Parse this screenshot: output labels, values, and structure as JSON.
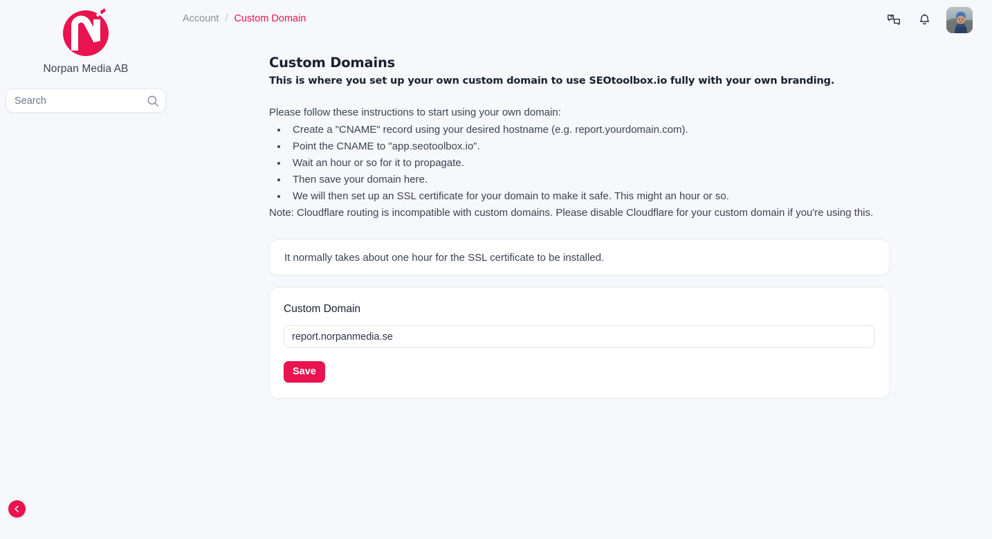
{
  "brand": {
    "name": "Norpan Media AB",
    "logo_icon": "norpan-n-monogram-logo",
    "accent_color": "#e8134f"
  },
  "sidebar": {
    "search": {
      "placeholder": "Search",
      "value": "",
      "icon": "search-icon"
    },
    "collapse_button_icon": "chevron-left-icon"
  },
  "header": {
    "breadcrumb": {
      "parent": "Account",
      "separator": "/",
      "current": "Custom Domain"
    },
    "actions": {
      "support_chat_icon": "chat-question-icon",
      "notifications_icon": "bell-icon",
      "avatar": "user-avatar"
    }
  },
  "main": {
    "title": "Custom Domains",
    "subtitle": "This is where you set up your own custom domain to use SEOtoolbox.io fully with your own branding.",
    "instructions_intro": "Please follow these instructions to start using your own domain:",
    "instructions": [
      "Create a \"CNAME\" record using your desired hostname (e.g. report.yourdomain.com).",
      "Point the CNAME to \"app.seotoolbox.io\".",
      "Wait an hour or so for it to propagate.",
      "Then save your domain here.",
      "We will then set up an SSL certificate for your domain to make it safe. This might an hour or so."
    ],
    "note": "Note: Cloudflare routing is incompatible with custom domains. Please disable Cloudflare for your custom domain if you're using this.",
    "info_card": {
      "text": "It normally takes about one hour for the SSL certificate to be installed."
    },
    "form_card": {
      "label": "Custom Domain",
      "input_value": "report.norpanmedia.se",
      "input_placeholder": "",
      "save_label": "Save"
    }
  }
}
